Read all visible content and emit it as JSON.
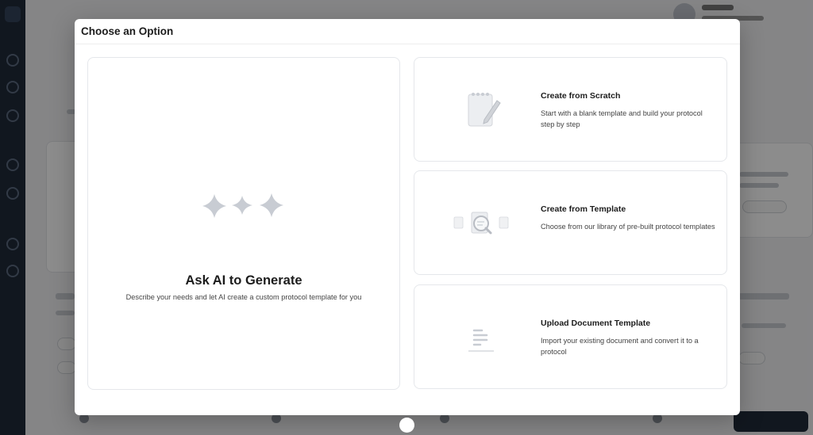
{
  "modal": {
    "title": "Choose an Option"
  },
  "options": {
    "ai": {
      "title": "Ask AI to Generate",
      "description": "Describe your needs and let AI create a custom protocol template for you",
      "icon": "sparkles-icon"
    },
    "scratch": {
      "title": "Create from Scratch",
      "description": "Start with a blank template and build your protocol step by step",
      "icon": "notepad-pencil-icon"
    },
    "template": {
      "title": "Create from Template",
      "description": "Choose from our library of pre-built protocol templates",
      "icon": "document-search-icon"
    },
    "upload": {
      "title": "Upload Document Template",
      "description": "Import your existing document and convert it to a protocol",
      "icon": "document-lines-icon"
    }
  },
  "colors": {
    "overlay": "rgba(0,0,0,0.45)",
    "icon_gray": "#c8ccd3",
    "sidebar": "#1f2a3a"
  }
}
